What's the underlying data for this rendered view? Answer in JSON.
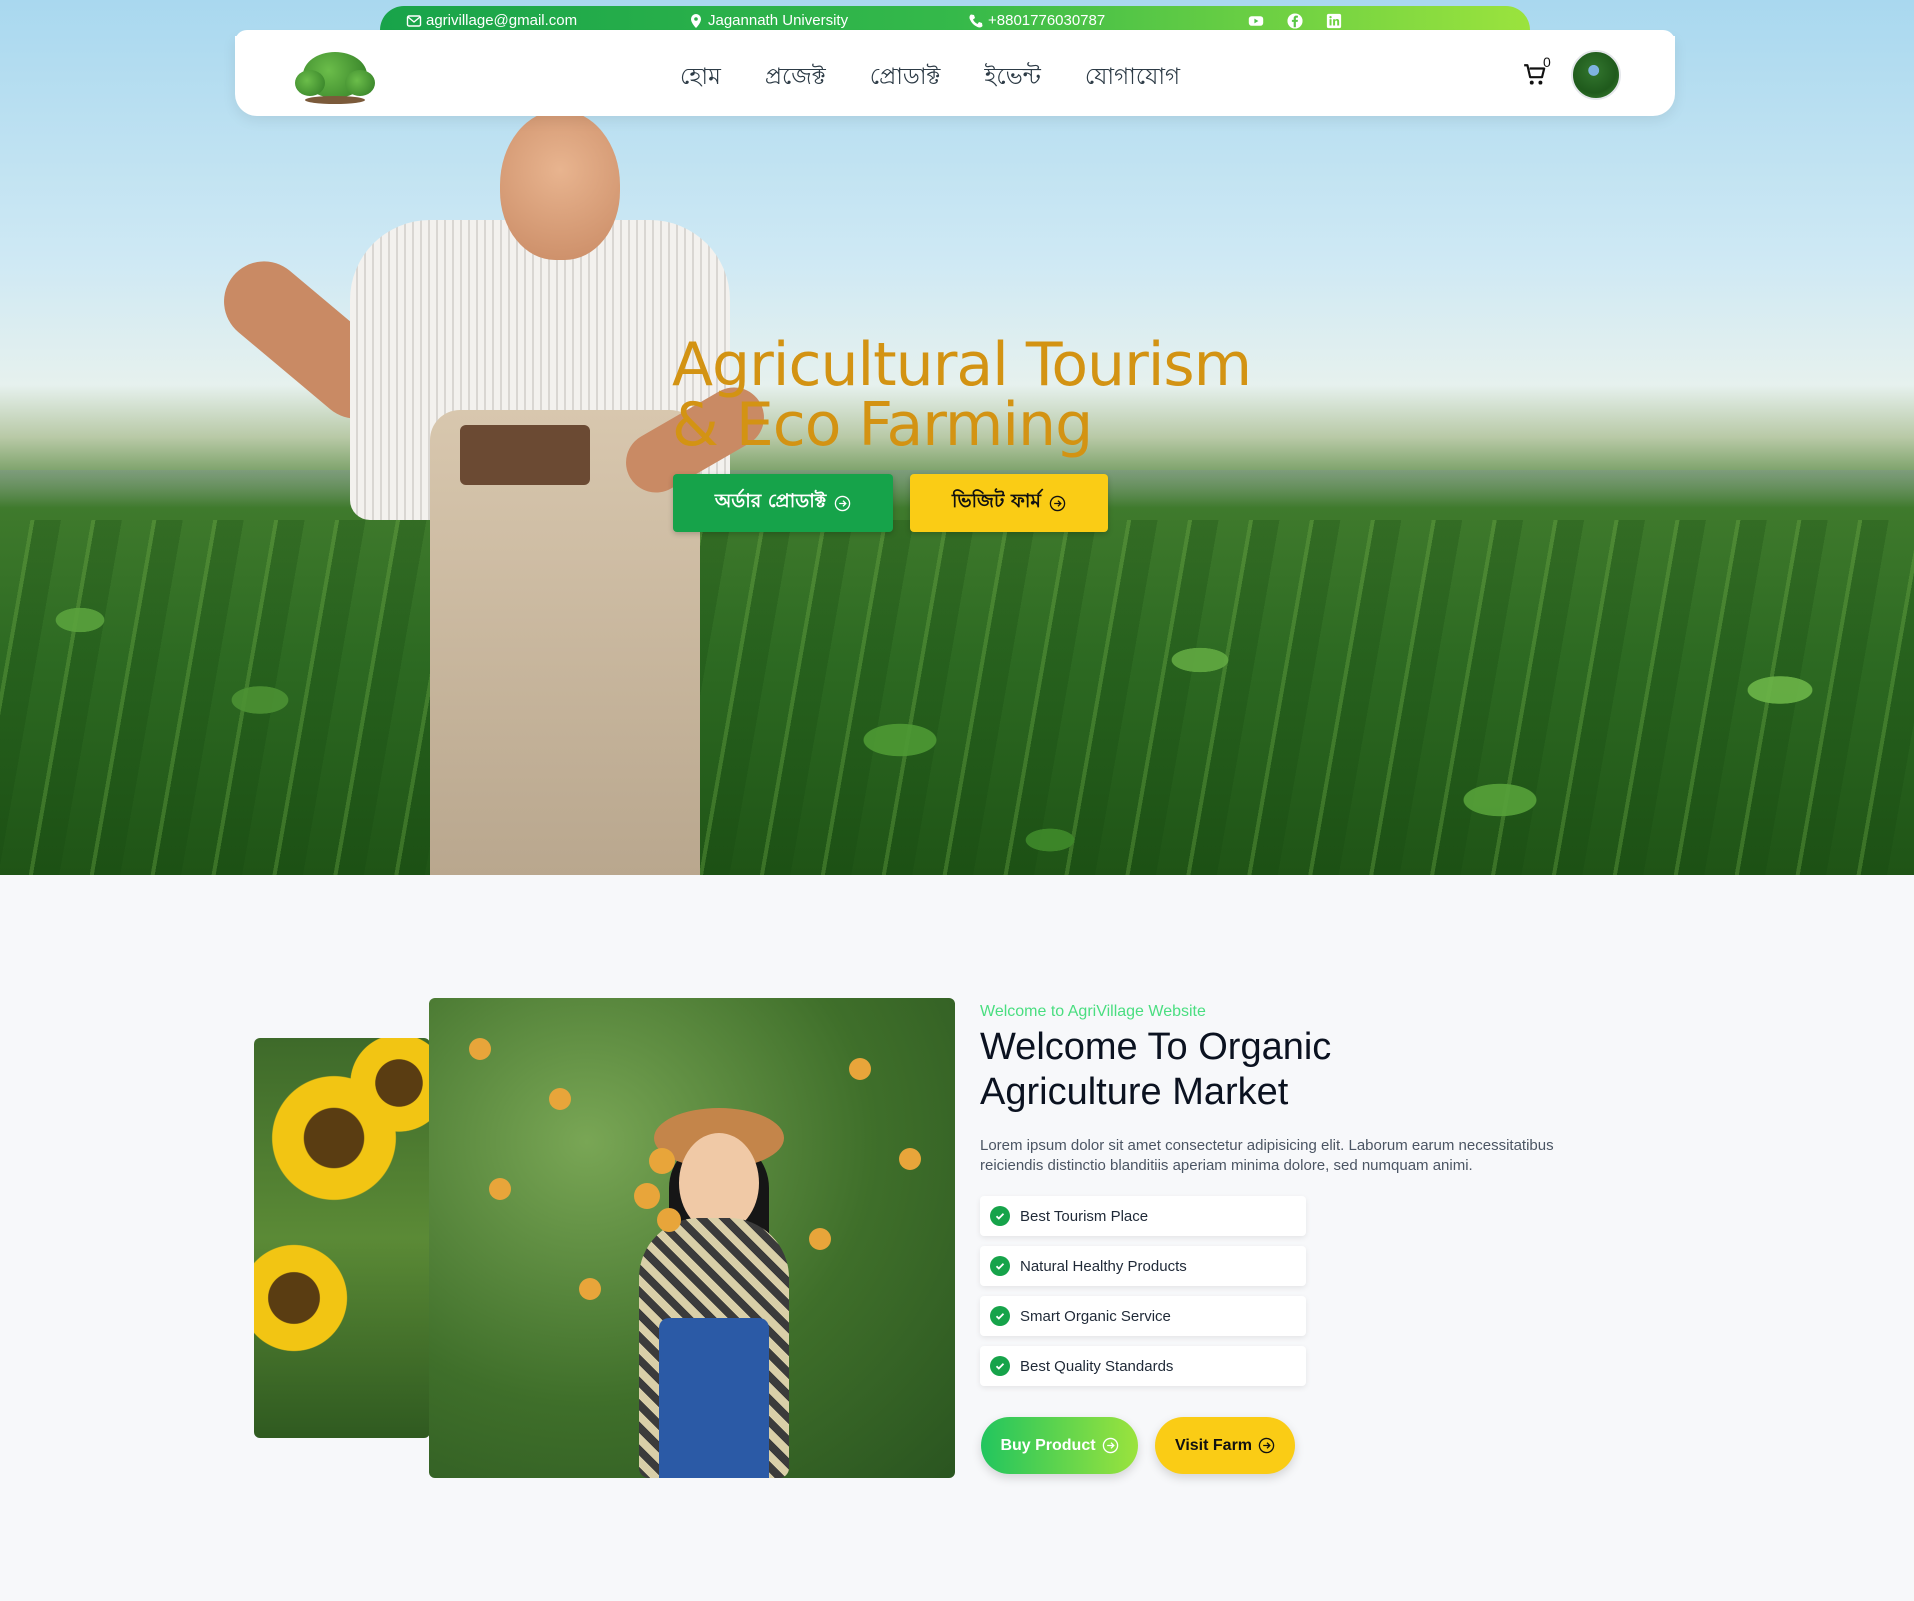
{
  "topbar": {
    "email": "agrivillage@gmail.com",
    "location": "Jagannath University",
    "phone": "+8801776030787",
    "social_icons": [
      "youtube-icon",
      "facebook-icon",
      "linkedin-icon"
    ]
  },
  "nav": {
    "items": [
      "হোম",
      "প্রজেক্ট",
      "প্রোডাক্ট",
      "ইভেন্ট",
      "যোগাযোগ"
    ],
    "cart_count": "0"
  },
  "hero": {
    "title_line1": "Agricultural Tourism",
    "title_line2": "& Eco Farming",
    "order_button": "অর্ডার প্রোডাক্ট",
    "visit_button": "ভিজিট ফার্ম"
  },
  "about": {
    "subtitle": "Welcome to AgriVillage Website",
    "title": "Welcome To Organic Agriculture Market",
    "description": "Lorem ipsum dolor sit amet consectetur adipisicing elit. Laborum earum necessitatibus reiciendis distinctio blanditiis aperiam minima dolore, sed numquam animi.",
    "features": [
      "Best Tourism Place",
      "Natural Healthy Products",
      "Smart Organic Service",
      "Best Quality Standards"
    ],
    "buy_button": "Buy Product",
    "farm_button": "Visit Farm"
  },
  "colors": {
    "green": "#16a34a",
    "yellow": "#facc15",
    "title_gold": "#d39313",
    "light_green": "#4ade80"
  }
}
